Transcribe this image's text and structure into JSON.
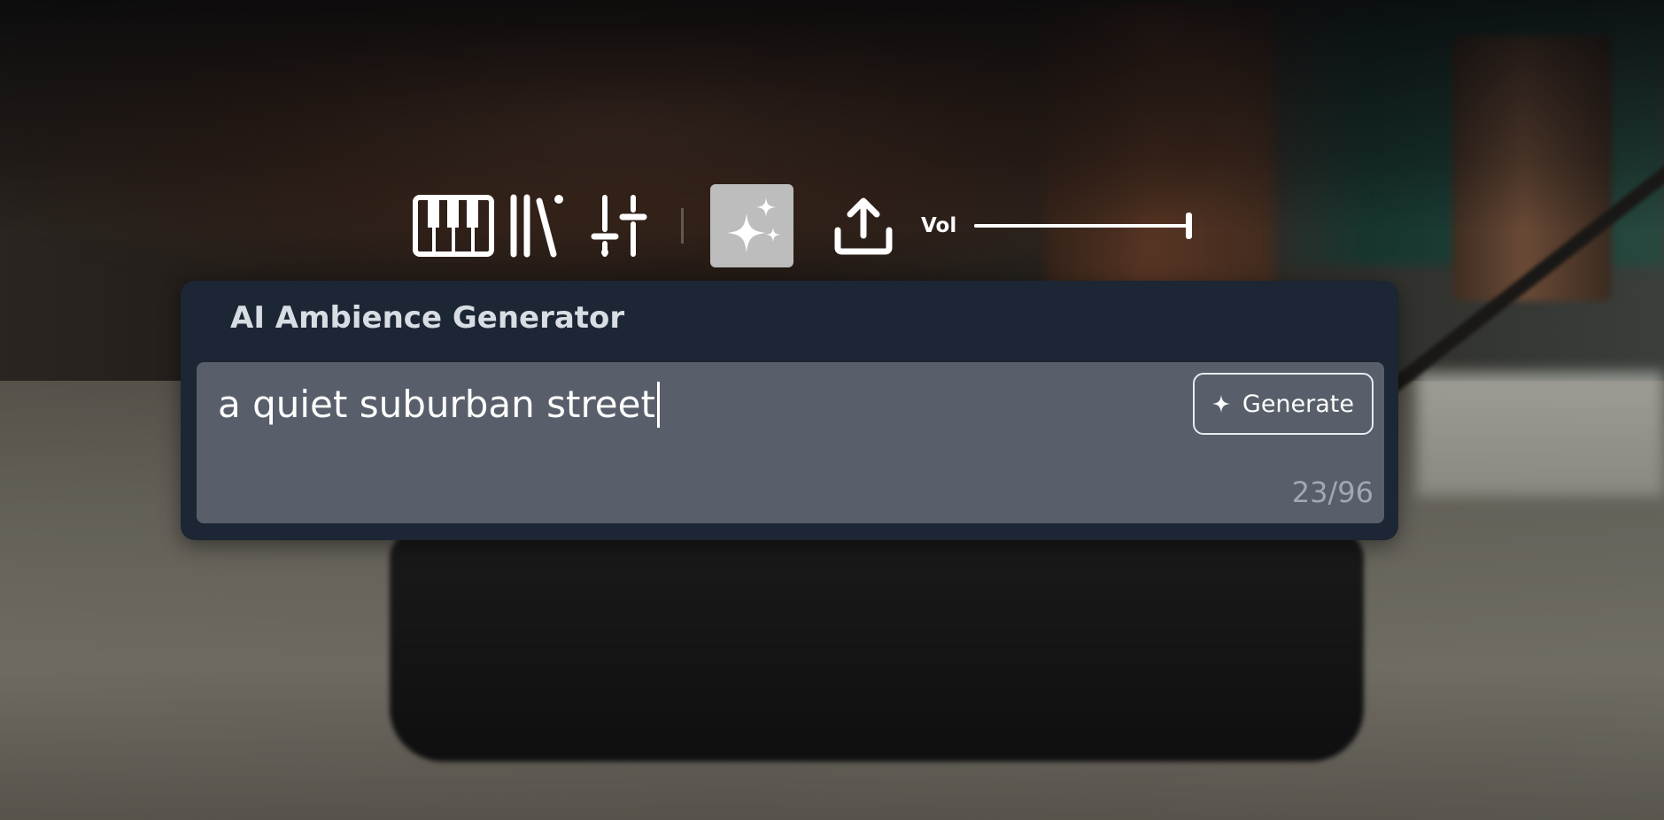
{
  "toolbar": {
    "tools": [
      {
        "name": "piano",
        "icon": "piano-keys-icon"
      },
      {
        "name": "library",
        "icon": "library-icon"
      },
      {
        "name": "mixer",
        "icon": "sliders-icon"
      },
      {
        "name": "ai-generate",
        "icon": "sparkles-icon",
        "active": true
      },
      {
        "name": "export",
        "icon": "upload-icon"
      }
    ],
    "volume": {
      "label": "Vol",
      "level": 1.0
    }
  },
  "generator": {
    "title": "AI Ambience Generator",
    "prompt_value": "a quiet suburban street",
    "generate_label": "Generate",
    "generate_icon": "sparkle-icon",
    "char_count": "23/96"
  },
  "colors": {
    "panel_bg": "#1c2634",
    "input_bg": "#585f6a",
    "active_tool_bg": "#bdbdbd",
    "counter_text": "#a2a8b1"
  }
}
